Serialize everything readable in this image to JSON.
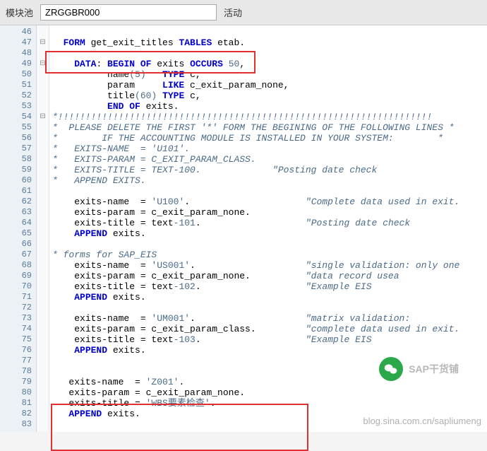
{
  "header": {
    "label": "模块池",
    "value": "ZRGGBR000",
    "status": "活动"
  },
  "logo_text": "SAP干货铺",
  "watermark": "blog.sina.com.cn/sapliumeng",
  "gutter": [
    "46",
    "47",
    "48",
    "49",
    "50",
    "51",
    "52",
    "53",
    "54",
    "55",
    "56",
    "57",
    "58",
    "59",
    "60",
    "61",
    "62",
    "63",
    "64",
    "65",
    "66",
    "67",
    "68",
    "69",
    "70",
    "71",
    "72",
    "73",
    "74",
    "75",
    "76",
    "77",
    "78",
    "79",
    "80",
    "81",
    "82",
    "83"
  ],
  "fold": [
    "",
    "⊟",
    "",
    "⊟",
    "",
    "",
    "",
    "",
    "⊟",
    "",
    "",
    "",
    "",
    "",
    "",
    "",
    "",
    "",
    "",
    "",
    "",
    "",
    "",
    "",
    "",
    "",
    "",
    "",
    "",
    "",
    "",
    "",
    "",
    "",
    "",
    "",
    "",
    ""
  ],
  "lines": [
    {
      "t": "plain",
      "pre": "",
      "text": ""
    },
    {
      "t": "form",
      "pre": "  "
    },
    {
      "t": "plain",
      "pre": "",
      "text": ""
    },
    {
      "t": "data_begin",
      "pre": "    "
    },
    {
      "t": "data_name",
      "pre": "          "
    },
    {
      "t": "data_param",
      "pre": "          "
    },
    {
      "t": "data_title",
      "pre": "          "
    },
    {
      "t": "data_end",
      "pre": "          "
    },
    {
      "t": "cmt",
      "pre": "",
      "text": "*!!!!!!!!!!!!!!!!!!!!!!!!!!!!!!!!!!!!!!!!!!!!!!!!!!!!!!!!!!!!!!!!!!!!"
    },
    {
      "t": "cmt",
      "pre": "",
      "text": "*  PLEASE DELETE THE FIRST '*' FORM THE BEGINING OF THE FOLLOWING LINES *"
    },
    {
      "t": "cmt",
      "pre": "",
      "text": "*        IF THE ACCOUNTING MODULE IS INSTALLED IN YOUR SYSTEM:        *"
    },
    {
      "t": "cmt",
      "pre": "",
      "text": "*   EXITS-NAME  = 'U101'."
    },
    {
      "t": "cmt",
      "pre": "",
      "text": "*   EXITS-PARAM = C_EXIT_PARAM_CLASS."
    },
    {
      "t": "cmt",
      "pre": "",
      "text": "*   EXITS-TITLE = TEXT-100.             \"Posting date check"
    },
    {
      "t": "cmt",
      "pre": "",
      "text": "*   APPEND EXITS."
    },
    {
      "t": "plain",
      "pre": "",
      "text": ""
    },
    {
      "t": "assign_str",
      "pre": "    ",
      "lhs": "exits-name  = ",
      "val": "'U100'",
      "tail": ".",
      "cmt": "\"Complete data used in exit."
    },
    {
      "t": "assign_id",
      "pre": "    ",
      "lhs": "exits-param = ",
      "val": "c_exit_param_none",
      "tail": ".",
      "cmt": ""
    },
    {
      "t": "assign_text",
      "pre": "    ",
      "lhs": "exits-title = ",
      "pfx": "text",
      "n": "-101",
      "tail": ".",
      "cmt": "\"Posting date check"
    },
    {
      "t": "append",
      "pre": "    "
    },
    {
      "t": "plain",
      "pre": "",
      "text": ""
    },
    {
      "t": "cmt",
      "pre": "",
      "text": "* forms for SAP_EIS"
    },
    {
      "t": "assign_str",
      "pre": "    ",
      "lhs": "exits-name  = ",
      "val": "'US001'",
      "tail": ".",
      "cmt": "\"single validation: only one"
    },
    {
      "t": "assign_id",
      "pre": "    ",
      "lhs": "exits-param = ",
      "val": "c_exit_param_none",
      "tail": ".",
      "cmt": "\"data record usea"
    },
    {
      "t": "assign_text",
      "pre": "    ",
      "lhs": "exits-title = ",
      "pfx": "text",
      "n": "-102",
      "tail": ".",
      "cmt": "\"Example EIS"
    },
    {
      "t": "append",
      "pre": "    "
    },
    {
      "t": "plain",
      "pre": "",
      "text": ""
    },
    {
      "t": "assign_str",
      "pre": "    ",
      "lhs": "exits-name  = ",
      "val": "'UM001'",
      "tail": ".",
      "cmt": "\"matrix validation:"
    },
    {
      "t": "assign_id",
      "pre": "    ",
      "lhs": "exits-param = ",
      "val": "c_exit_param_class",
      "tail": ".",
      "cmt": "\"complete data used in exit."
    },
    {
      "t": "assign_text",
      "pre": "    ",
      "lhs": "exits-title = ",
      "pfx": "text",
      "n": "-103",
      "tail": ".",
      "cmt": "\"Example EIS"
    },
    {
      "t": "append",
      "pre": "    "
    },
    {
      "t": "plain",
      "pre": "",
      "text": ""
    },
    {
      "t": "plain",
      "pre": "",
      "text": ""
    },
    {
      "t": "assign_str",
      "pre": "   ",
      "lhs": "exits-name  = ",
      "val": "'Z001'",
      "tail": ".",
      "cmt": ""
    },
    {
      "t": "assign_id",
      "pre": "   ",
      "lhs": "exits-param = ",
      "val": "c_exit_param_none",
      "tail": ".",
      "cmt": ""
    },
    {
      "t": "assign_str_cn",
      "pre": "   ",
      "lhs": "exits-title = ",
      "val": "'WBS要素检查'",
      "tail": ".",
      "cmt": ""
    },
    {
      "t": "append",
      "pre": "   "
    },
    {
      "t": "plain",
      "pre": "",
      "text": ""
    }
  ],
  "kw": {
    "FORM": "FORM",
    "TABLES": "TABLES",
    "DATA": "DATA",
    "BEGIN": "BEGIN",
    "OF": "OF",
    "OCCURS": "OCCURS",
    "TYPE": "TYPE",
    "LIKE": "LIKE",
    "END": "END",
    "APPEND": "APPEND"
  }
}
